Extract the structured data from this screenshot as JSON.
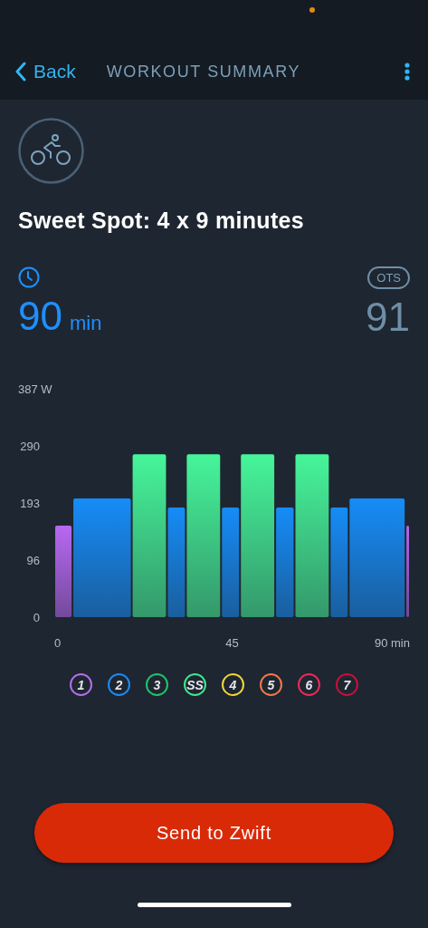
{
  "nav": {
    "back": "Back",
    "title": "WORKOUT SUMMARY"
  },
  "workout": {
    "title": "Sweet Spot: 4 x 9 minutes",
    "duration": "90",
    "duration_unit": "min",
    "ots_label": "OTS",
    "ots_value": "91"
  },
  "chart_data": {
    "type": "bar",
    "xlim": [
      0,
      90
    ],
    "ylim": [
      0,
      387
    ],
    "x": [
      2.3,
      12.1,
      24.05,
      30.9,
      37.75,
      44.6,
      51.45,
      58.35,
      65.25,
      72.1,
      81.7,
      89.45
    ],
    "values": [
      155,
      201,
      276,
      186,
      276,
      186,
      276,
      186,
      276,
      186,
      201,
      155
    ],
    "colors": [
      "#b868f2",
      "#168cf7",
      "#46f59a",
      "#168cf7",
      "#46f59a",
      "#168cf7",
      "#46f59a",
      "#168cf7",
      "#46f59a",
      "#168cf7",
      "#168cf7",
      "#b868f2"
    ],
    "yticks": [
      0,
      96,
      193,
      290,
      {
        "value": 387,
        "label": "387 W"
      }
    ],
    "xticks": [
      0,
      45,
      {
        "value": 90,
        "label": "90 min"
      }
    ]
  },
  "zones": [
    {
      "label": "1",
      "color": "#b56ee8"
    },
    {
      "label": "2",
      "color": "#1a8cf5"
    },
    {
      "label": "3",
      "color": "#1fc46a"
    },
    {
      "label": "SS",
      "color": "#3ee88c"
    },
    {
      "label": "4",
      "color": "#f2d53a"
    },
    {
      "label": "5",
      "color": "#f2784a"
    },
    {
      "label": "6",
      "color": "#ee2a55"
    },
    {
      "label": "7",
      "color": "#c8103a"
    }
  ],
  "action": {
    "label": "Send to Zwift"
  }
}
